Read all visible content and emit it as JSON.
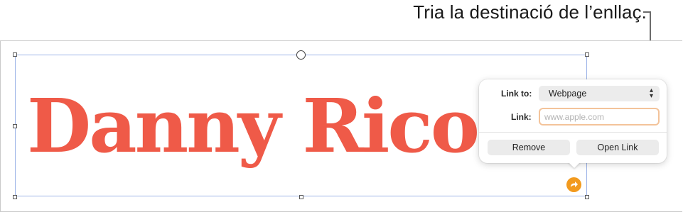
{
  "callout": {
    "text": "Tria la destinació de l’enllaç."
  },
  "textbox": {
    "text": "Danny Rico"
  },
  "popover": {
    "link_to_label": "Link to:",
    "link_to_value": "Webpage",
    "link_label": "Link:",
    "link_placeholder": "www.apple.com",
    "remove_label": "Remove",
    "open_link_label": "Open Link"
  },
  "icons": {
    "select_chevron": "up-down-chevron-icon",
    "link_badge": "arrow-curve-icon"
  },
  "colors": {
    "title_text": "#ef5a48",
    "link_badge": "#f29a1e",
    "selection_border": "#9db4e8",
    "input_focus": "#f3c39a"
  }
}
